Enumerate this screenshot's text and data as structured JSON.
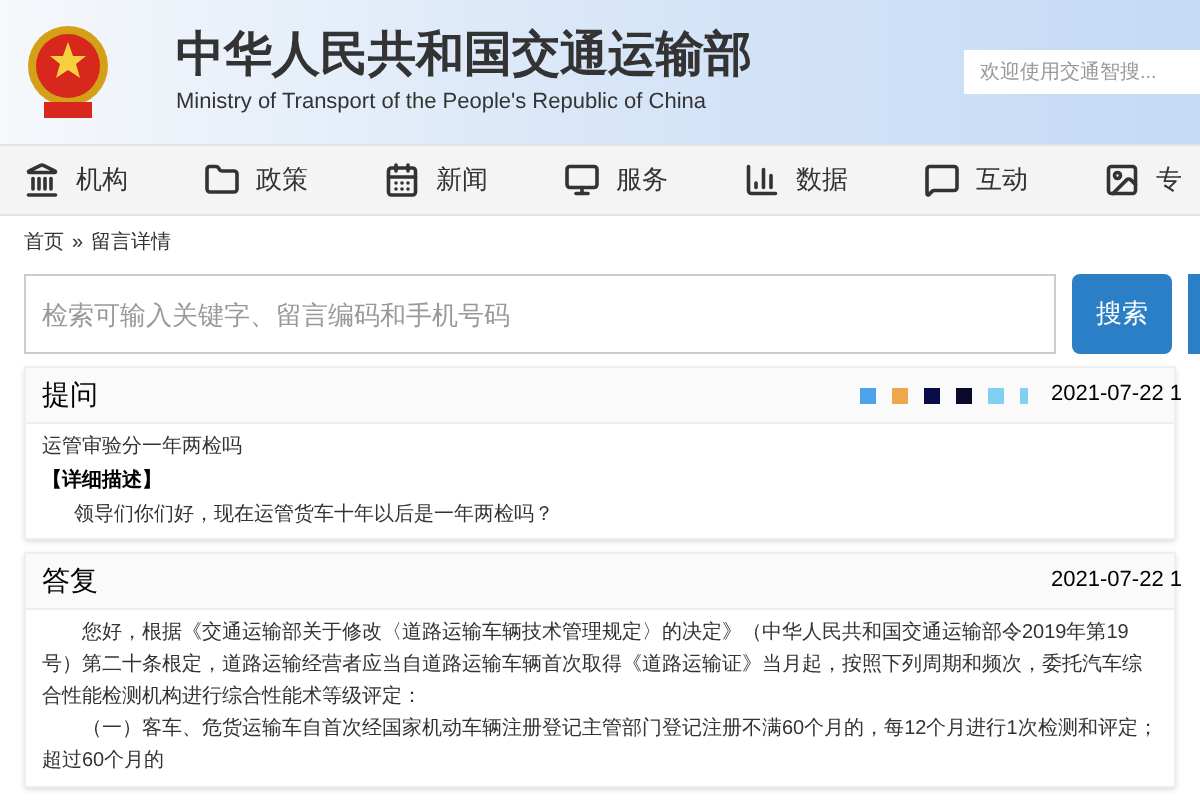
{
  "header": {
    "title": "中华人民共和国交通运输部",
    "subtitle": "Ministry of Transport of the People's Republic of China",
    "search": {
      "placeholder": "欢迎使用交通智搜..."
    }
  },
  "nav": [
    {
      "label": "机构"
    },
    {
      "label": "政策"
    },
    {
      "label": "新闻"
    },
    {
      "label": "服务"
    },
    {
      "label": "数据"
    },
    {
      "label": "互动"
    },
    {
      "label": "专"
    }
  ],
  "breadcrumb": {
    "items": [
      "首页",
      "留言详情"
    ],
    "separator": "»"
  },
  "search": {
    "placeholder": "检索可输入关键字、留言编码和手机号码",
    "button": "搜索"
  },
  "question": {
    "heading": "提问",
    "date": "2021-07-22 1",
    "title": "运管审验分一年两检吗",
    "detail_label": "【详细描述】",
    "detail": "领导们你们好，现在运管货车十年以后是一年两检吗？"
  },
  "answer": {
    "heading": "答复",
    "date": "2021-07-22 1",
    "paragraphs": [
      "您好，根据《交通运输部关于修改〈道路运输车辆技术管理规定〉的决定》（中华人民共和国交通运输部令2019年第19号）第二十条根定，道路运输经营者应当自道路运输车辆首次取得《道路运输证》当月起，按照下列周期和频次，委托汽车综合性能检测机构进行综合性能术等级评定：",
      "（一）客车、危货运输车自首次经国家机动车辆注册登记主管部门登记注册不满60个月的，每12个月进行1次检测和评定；超过60个月的"
    ]
  }
}
